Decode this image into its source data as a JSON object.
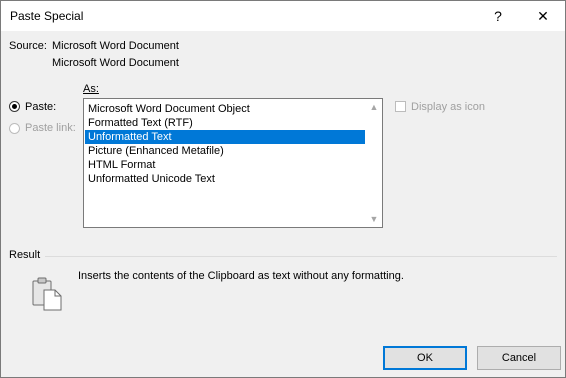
{
  "window": {
    "title": "Paste Special",
    "help_glyph": "?",
    "close_glyph": "✕"
  },
  "source": {
    "label": "Source:",
    "line1": "Microsoft Word Document",
    "line2": "Microsoft Word Document"
  },
  "as_label": "As:",
  "options": {
    "paste_label": "Paste:",
    "paste_link_label": "Paste link:",
    "selected": "paste"
  },
  "list": {
    "items": [
      "Microsoft Word Document Object",
      "Formatted Text (RTF)",
      "Unformatted Text",
      "Picture (Enhanced Metafile)",
      "HTML Format",
      "Unformatted Unicode Text"
    ],
    "selected_index": 2
  },
  "display_as_icon": {
    "label": "Display as icon",
    "checked": false
  },
  "result": {
    "label": "Result",
    "description": "Inserts the contents of the Clipboard as text without any formatting."
  },
  "buttons": {
    "ok": "OK",
    "cancel": "Cancel"
  },
  "colors": {
    "selection": "#0078d7",
    "dialog_bg": "#f0f0f0"
  }
}
